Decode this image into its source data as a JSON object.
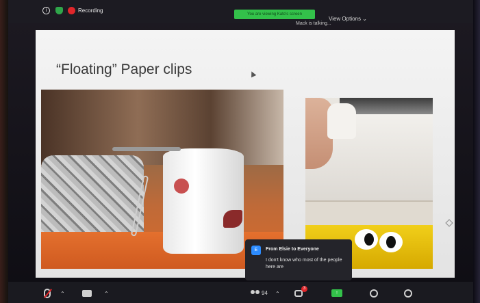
{
  "top_bar": {
    "recording_label": "Recording",
    "share_banner": "You are viewing Kate's screen",
    "view_options_label": "View Options ⌄",
    "talking_label": "Mack is talking..."
  },
  "slide": {
    "title": "“Floating” Paper clips"
  },
  "chat_toast": {
    "avatar_initial": "E",
    "from": "From Elsie to Everyone",
    "message": "I don't know who most of the people here are"
  },
  "toolbar": {
    "participants_count": "94",
    "chat_unread": "3",
    "share_glyph": "↑",
    "caret": "⌃"
  },
  "colors": {
    "accent_green": "#33c14a",
    "alert_red": "#e0262a",
    "avatar_blue": "#2d8cff"
  }
}
